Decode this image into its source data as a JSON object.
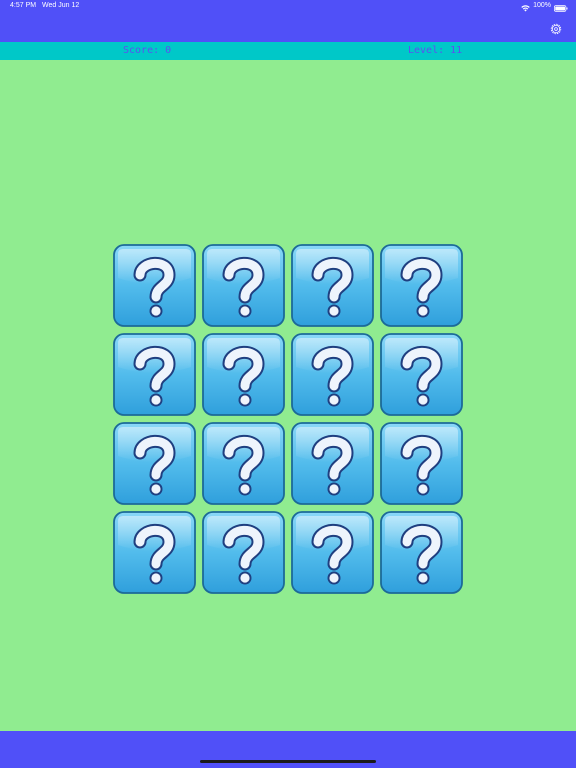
{
  "status_bar": {
    "time": "4:57 PM",
    "date": "Wed Jun 12",
    "battery": "100%",
    "icons": [
      "wifi-icon",
      "battery-icon"
    ]
  },
  "header": {
    "settings_icon": "gear-icon",
    "score_label": "Score: 0",
    "level_label": "Level: 11"
  },
  "board": {
    "rows": 4,
    "columns": 4,
    "card_face": "question-mark",
    "cards_face_down": 16
  },
  "colors": {
    "top_bar": "#5050f8",
    "score_bar": "#00c8c8",
    "score_text": "#5a52f0",
    "background": "#90ec90",
    "card": "#4ab8e8"
  }
}
